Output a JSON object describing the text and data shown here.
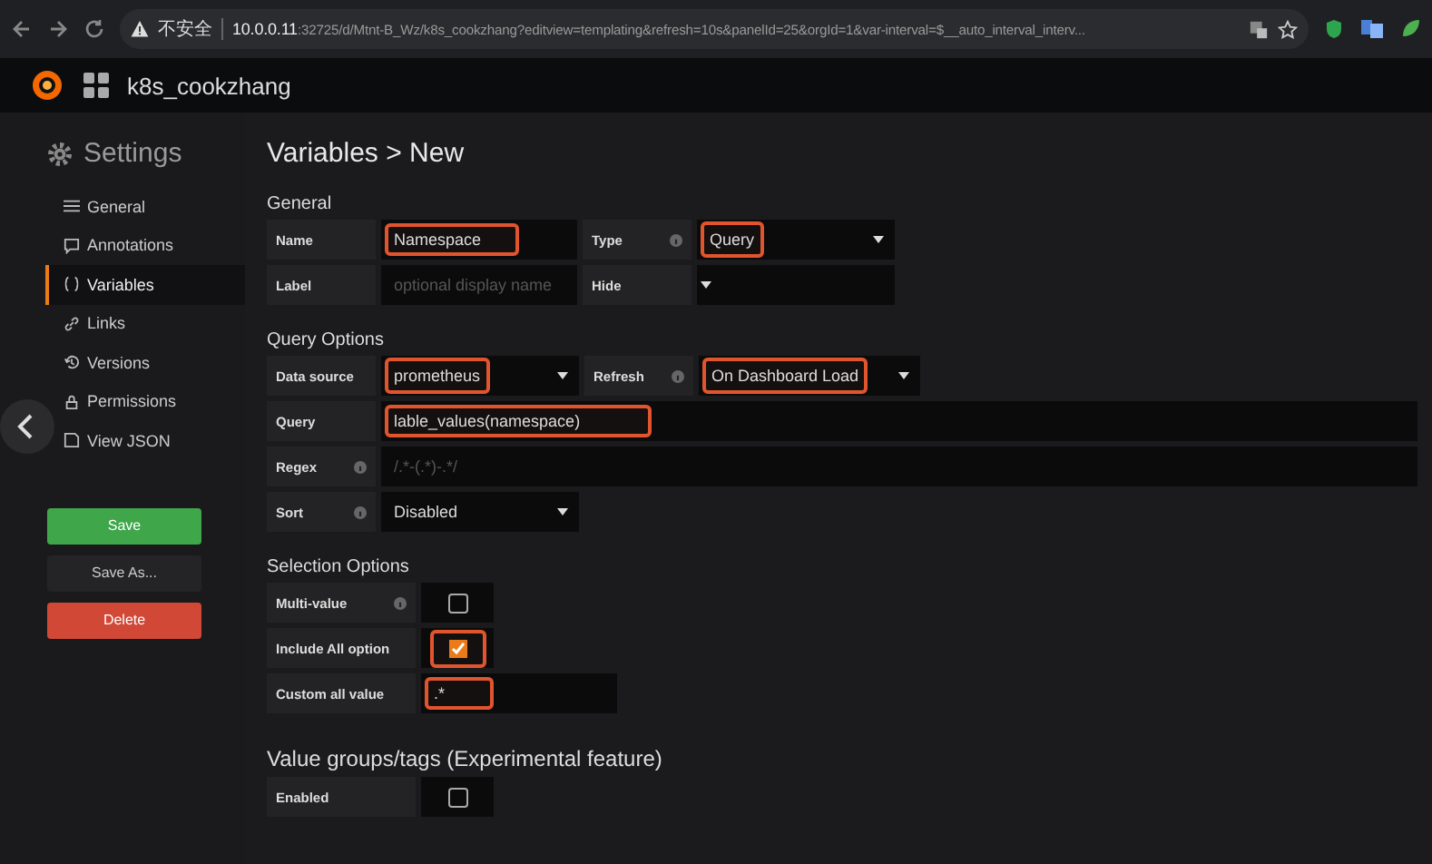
{
  "browser": {
    "security": "不安全",
    "url_host": "10.0.0.11",
    "url_rest": ":32725/d/Mtnt-B_Wz/k8s_cookzhang?editview=templating&refresh=10s&panelId=25&orgId=1&var-interval=$__auto_interval_interv..."
  },
  "navbar": {
    "dashboard": "k8s_cookzhang"
  },
  "sidebar": {
    "title": "Settings",
    "items": [
      {
        "label": "General",
        "selected": false
      },
      {
        "label": "Annotations",
        "selected": false
      },
      {
        "label": "Variables",
        "selected": true
      },
      {
        "label": "Links",
        "selected": false
      },
      {
        "label": "Versions",
        "selected": false
      },
      {
        "label": "Permissions",
        "selected": false
      },
      {
        "label": "View JSON",
        "selected": false
      }
    ],
    "buttons": [
      {
        "label": "Save",
        "kind": "save"
      },
      {
        "label": "Save As...",
        "kind": "saveas"
      },
      {
        "label": "Delete",
        "kind": "delete"
      }
    ]
  },
  "page_title": "Variables > New",
  "sections": [
    {
      "title": "General",
      "rows": [
        [
          {
            "kind": "label",
            "text": "Name",
            "info": false
          },
          {
            "kind": "input",
            "value": "Namespace",
            "highlighted": true
          },
          {
            "kind": "label",
            "text": "Type",
            "info": true
          },
          {
            "kind": "select",
            "value": "Query",
            "highlighted": true
          }
        ],
        [
          {
            "kind": "label",
            "text": "Label",
            "info": false
          },
          {
            "kind": "input",
            "placeholder": "optional display name",
            "highlighted": false
          },
          {
            "kind": "label",
            "text": "Hide",
            "info": false
          },
          {
            "kind": "select"
          }
        ]
      ]
    },
    {
      "title": "Query Options",
      "rows": [
        [
          {
            "kind": "label",
            "text": "Data source",
            "info": false
          },
          {
            "kind": "select",
            "value": "prometheus",
            "highlighted": true
          },
          {
            "kind": "label",
            "text": "Refresh",
            "info": true
          },
          {
            "kind": "select_wide",
            "value": "On Dashboard Load",
            "highlighted": true
          }
        ],
        [
          {
            "kind": "label",
            "text": "Query",
            "info": false
          },
          {
            "kind": "input_wide",
            "value": "lable_values(namespace)",
            "highlighted": true
          }
        ],
        [
          {
            "kind": "label",
            "text": "Regex",
            "info": true
          },
          {
            "kind": "input_wide",
            "placeholder": "/.*-(.*)-.*/",
            "highlighted": false
          }
        ],
        [
          {
            "kind": "label",
            "text": "Sort",
            "info": true
          },
          {
            "kind": "select",
            "value": "Disabled",
            "highlighted": false
          }
        ]
      ]
    },
    {
      "title": "Selection Options",
      "rows": [
        [
          {
            "kind": "label_wide",
            "text": "Multi-value",
            "info": true
          },
          {
            "kind": "checkbox",
            "checked": false,
            "highlighted": false
          }
        ],
        [
          {
            "kind": "label_wide",
            "text": "Include All option",
            "info": false
          },
          {
            "kind": "checkbox",
            "checked": true,
            "highlighted": true
          }
        ],
        [
          {
            "kind": "label_wide",
            "text": "Custom all value",
            "info": false
          },
          {
            "kind": "input",
            "value": ".*",
            "highlighted": true
          }
        ]
      ]
    },
    {
      "title": "Value groups/tags (Experimental feature)",
      "rows": [
        [
          {
            "kind": "label_wide",
            "text": "Enabled",
            "info": false
          },
          {
            "kind": "checkbox",
            "checked": false,
            "highlighted": false
          }
        ]
      ]
    }
  ]
}
